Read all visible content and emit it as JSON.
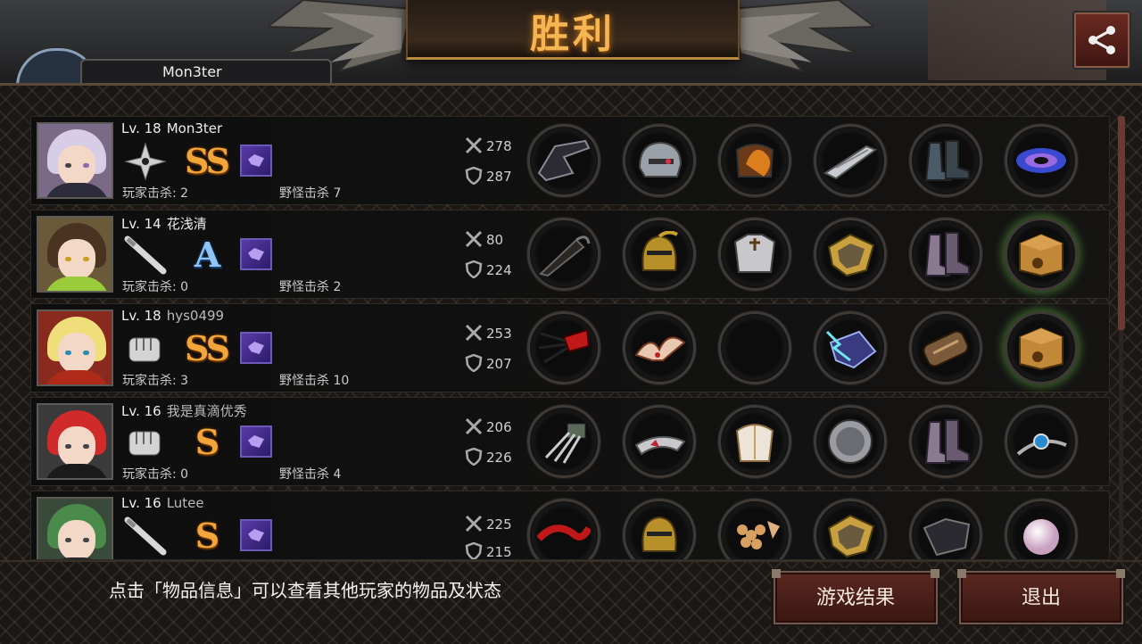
{
  "header": {
    "title": "胜利",
    "self_name": "Mon3ter",
    "share_icon": "share-icon"
  },
  "colors": {
    "title": "#f4b552",
    "grade_ss": "#f2a53a",
    "grade_a": "#8fc4f4",
    "button_bg": "#5a2820"
  },
  "players": [
    {
      "level": "Lv. 18",
      "name": "Mon3ter",
      "weapon": "shuriken-icon",
      "grade": "SS",
      "atk": "278",
      "def": "287",
      "player_kills": "玩家击杀: 2",
      "monster_kills": "野怪击杀 7",
      "items": [
        "dark-claw-weapon-icon",
        "steel-helmet-icon",
        "flaming-armor-icon",
        "metal-bracer-icon",
        "steel-boots-icon",
        "galaxy-orb-icon"
      ]
    },
    {
      "level": "Lv. 14",
      "name": "花浅清",
      "weapon": "baseball-bat-icon",
      "grade": "A",
      "atk": "80",
      "def": "224",
      "player_kills": "玩家击杀: 0",
      "monster_kills": "野怪击杀 2",
      "items": [
        "umbrella-icon",
        "gold-knight-helmet-icon",
        "silver-chestplate-icon",
        "gold-shield-icon",
        "purple-boots-icon",
        "mystery-box-icon"
      ]
    },
    {
      "level": "Lv. 18",
      "name": "hys0499",
      "weapon": "fist-icon",
      "grade": "SS",
      "atk": "253",
      "def": "207",
      "player_kills": "玩家击杀: 3",
      "monster_kills": "野怪击杀 10",
      "items": [
        "red-claw-glove-icon",
        "winged-tiara-icon",
        "empty-slot",
        "lightning-gauntlet-icon",
        "bronze-gauntlet-icon",
        "mystery-box-icon"
      ]
    },
    {
      "level": "Lv. 16",
      "name": "我是真滴优秀",
      "weapon": "fist-icon",
      "grade": "S",
      "atk": "206",
      "def": "226",
      "player_kills": "玩家击杀: 0",
      "monster_kills": "野怪击杀 4",
      "items": [
        "iron-claw-icon",
        "silver-tiara-icon",
        "white-armor-icon",
        "round-shield-icon",
        "purple-boots-icon",
        "blue-gem-bracelet-icon"
      ]
    },
    {
      "level": "Lv. 16",
      "name": "Lutee",
      "weapon": "baseball-bat-icon",
      "grade": "S",
      "atk": "225",
      "def": "215",
      "player_kills": "",
      "monster_kills": "",
      "items": [
        "red-chain-whip-icon",
        "gold-knight-helmet-icon",
        "gold-bead-armor-icon",
        "gold-shield-icon",
        "dark-boots-icon",
        "pearl-icon"
      ]
    }
  ],
  "footer": {
    "hint": "点击「物品信息」可以查看其他玩家的物品及状态",
    "result_button": "游戏结果",
    "exit_button": "退出"
  }
}
